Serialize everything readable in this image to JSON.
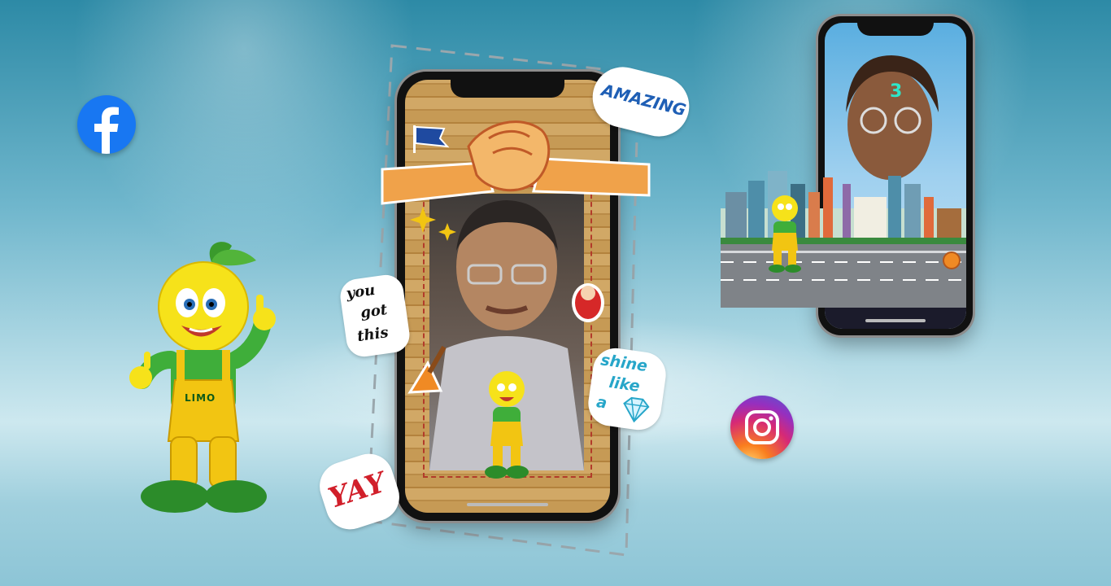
{
  "social": {
    "facebook_icon": "facebook-icon",
    "instagram_icon": "instagram-icon",
    "facebook_color": "#1877f2",
    "instagram_gradient": [
      "#feda75",
      "#fa7e1e",
      "#d62976",
      "#962fbf",
      "#4f5bd5"
    ]
  },
  "mascot": {
    "shirt_label": "LIMO",
    "colors": {
      "head": "#f6e21a",
      "shirt": "#3fae3a",
      "overalls": "#f2c512",
      "shoes": "#2c8c2a"
    }
  },
  "stickers": {
    "amazing": "AMAZING",
    "you_got_this": [
      "you",
      "got",
      "this"
    ],
    "yay": "YAY",
    "shine_like_a": [
      "shine",
      "like",
      "a"
    ]
  },
  "game_phone": {
    "countdown": "3"
  }
}
